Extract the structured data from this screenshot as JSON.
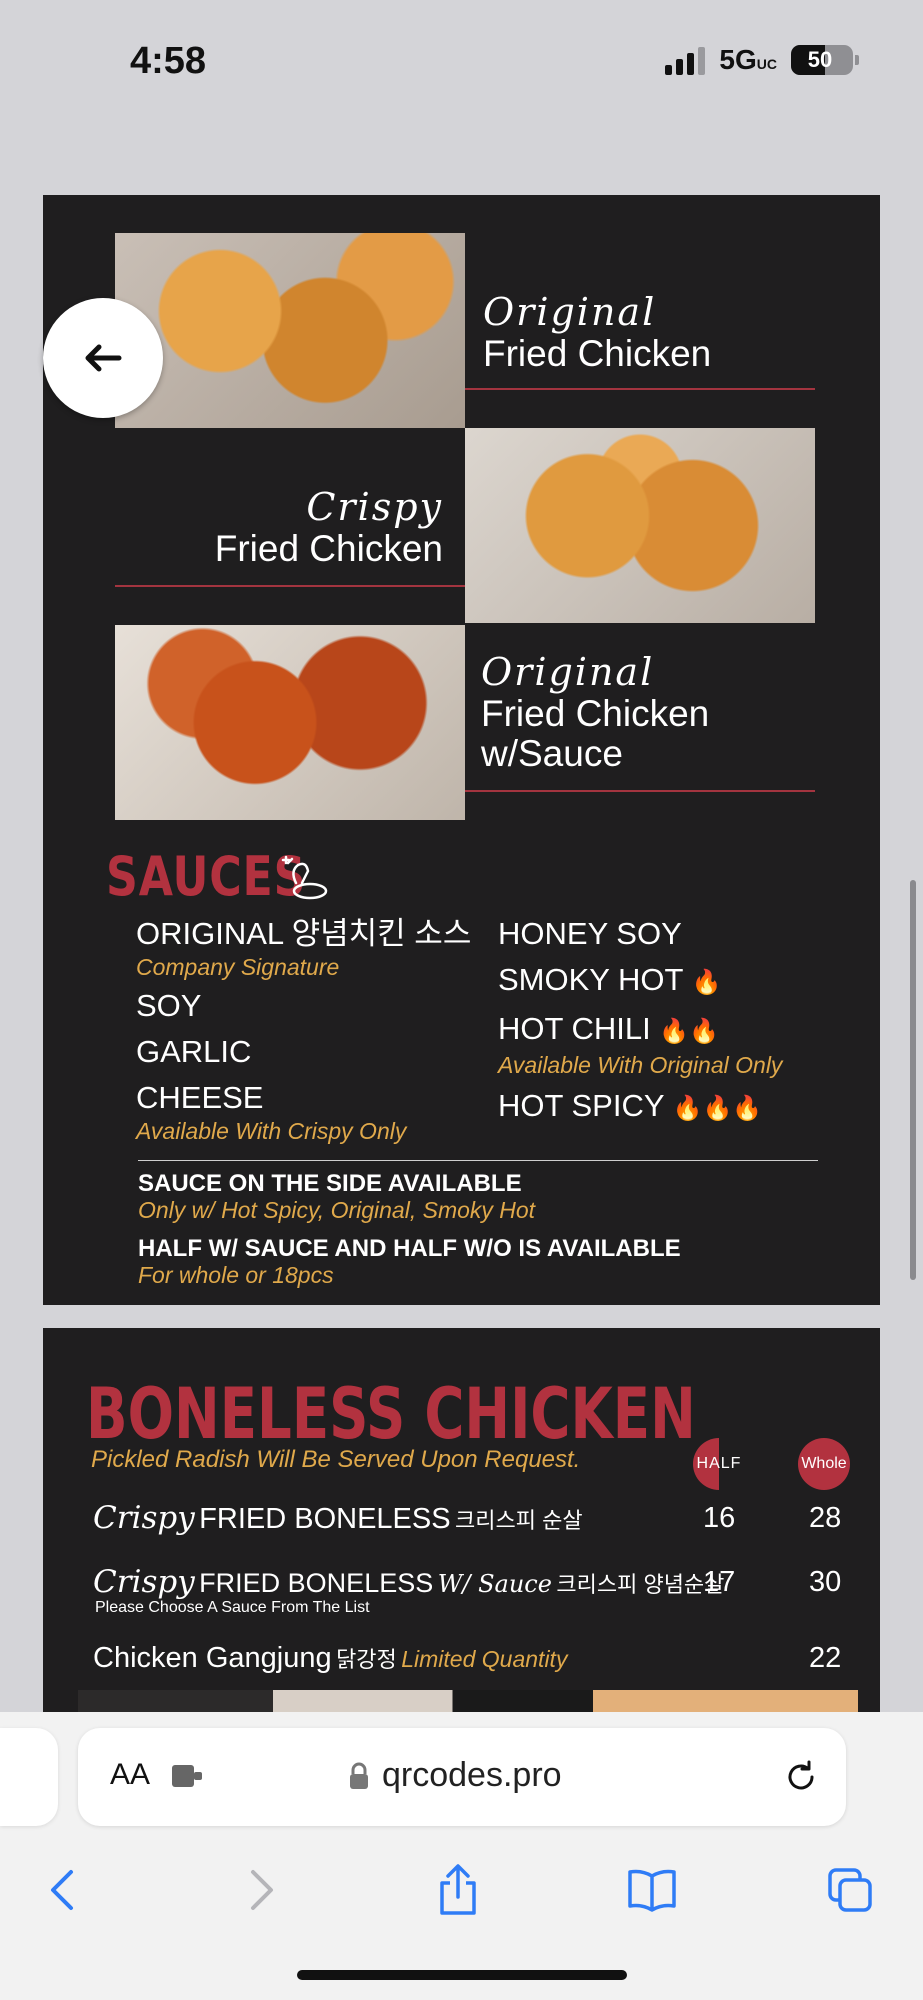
{
  "status_bar": {
    "time": "4:58",
    "network": "5G",
    "network_sub": "UC",
    "battery": "50"
  },
  "menu_items": [
    {
      "script": "Original",
      "name": "Fried Chicken",
      "extra": ""
    },
    {
      "script": "Crispy",
      "name": "Fried Chicken",
      "extra": ""
    },
    {
      "script": "Original",
      "name": "Fried Chicken",
      "extra": "w/Sauce"
    }
  ],
  "sauces": {
    "heading": "SAUCES",
    "left": [
      {
        "name": "ORIGINAL 양념치킨 소스",
        "note": "Company Signature"
      },
      {
        "name": "SOY",
        "note": ""
      },
      {
        "name": "GARLIC",
        "note": ""
      },
      {
        "name": "CHEESE",
        "note": "Available With Crispy Only"
      }
    ],
    "right": [
      {
        "name": "HONEY SOY",
        "fire": "",
        "note": ""
      },
      {
        "name": "SMOKY HOT",
        "fire": "🔥",
        "note": ""
      },
      {
        "name": "HOT CHILI",
        "fire": "🔥🔥",
        "note": "Available With Original Only"
      },
      {
        "name": "HOT SPICY",
        "fire": "🔥🔥🔥",
        "note": ""
      }
    ],
    "side_title": "SAUCE ON THE SIDE AVAILABLE",
    "side_note": "Only w/ Hot Spicy, Original, Smoky Hot",
    "half_title": "HALF W/ SAUCE AND HALF W/O IS AVAILABLE",
    "half_note": "For whole or 18pcs"
  },
  "boneless": {
    "heading": "BONELESS CHICKEN",
    "radish_note": "Pickled Radish Will Be Served Upon Request.",
    "badge_half": "HALF",
    "badge_whole": "Whole",
    "rows": [
      {
        "script": "Crispy",
        "name": "FRIED BONELESS",
        "sauce": "",
        "korean": "크리스피 순살",
        "note": "",
        "half": "16",
        "whole": "28"
      },
      {
        "script": "Crispy",
        "name": "FRIED BONELESS",
        "sauce": "W/ Sauce",
        "korean": "크리스피 양념순살",
        "note": "Please Choose A Sauce From The List",
        "half": "17",
        "whole": "30"
      },
      {
        "script": "",
        "name": "Chicken Gangjung",
        "sauce": "",
        "korean": "닭강정",
        "note": "Limited Quantity",
        "half": "",
        "whole": "22"
      }
    ]
  },
  "browser": {
    "aa_label": "AA",
    "url": "qrcodes.pro"
  }
}
